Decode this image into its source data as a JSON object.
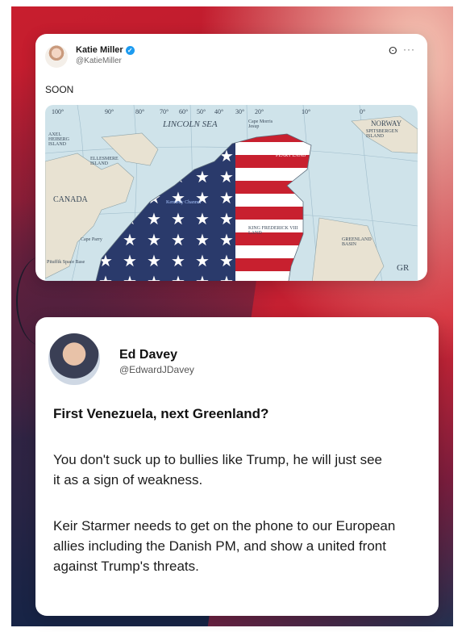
{
  "tweet1": {
    "author_name": "Katie Miller",
    "handle": "@KatieMiller",
    "text": "SOON",
    "icons": {
      "verified": "verified-badge-icon",
      "grok": "grok-icon",
      "more": "more-options-icon"
    },
    "map_labels": {
      "lincoln_sea": "LINCOLN SEA",
      "norway": "NORWAY",
      "spitsbergen": "SPITSBERGEN ISLAND",
      "axel_heiberg": "AXEL HEIBERG ISLAND",
      "ellesmere": "ELLESMERE ISLAND",
      "canada": "CANADA",
      "cape_morris_jesup": "Cape Morris Jesup",
      "peary_land": "PEARY LAND",
      "nares_strait": "Kennedy Channel",
      "fredrik_land": "KING FREDERICK VIII LAND",
      "greenland_basin": "GREENLAND BASIN",
      "cape_parry": "Cape Parry",
      "pituffik": "Pituffik Space Base",
      "gr": "GR",
      "lat_100": "100°",
      "lat_90": "90°",
      "lat_80": "80°",
      "lat_70": "70°",
      "lat_60": "60°",
      "lat_50": "50°",
      "lat_40": "40°",
      "lat_30": "30°",
      "lat_20": "20°",
      "lat_10": "10°",
      "lat_0": "0°"
    }
  },
  "tweet2": {
    "author_name": "Ed Davey",
    "handle": "@EdwardJDavey",
    "headline": "First Venezuela, next Greenland?",
    "paragraph1": "You don't suck up to bullies like Trump, he will just see it as a sign of weakness.",
    "paragraph2": "Keir Starmer needs to get on the phone to our European allies including the Danish PM, and show a united front against Trump's threats."
  },
  "colors": {
    "background_red": "#c81e2e",
    "background_navy": "#162446",
    "verified_blue": "#1d9bf0",
    "flag_red": "#c8202f",
    "flag_blue": "#2a3a6b"
  }
}
